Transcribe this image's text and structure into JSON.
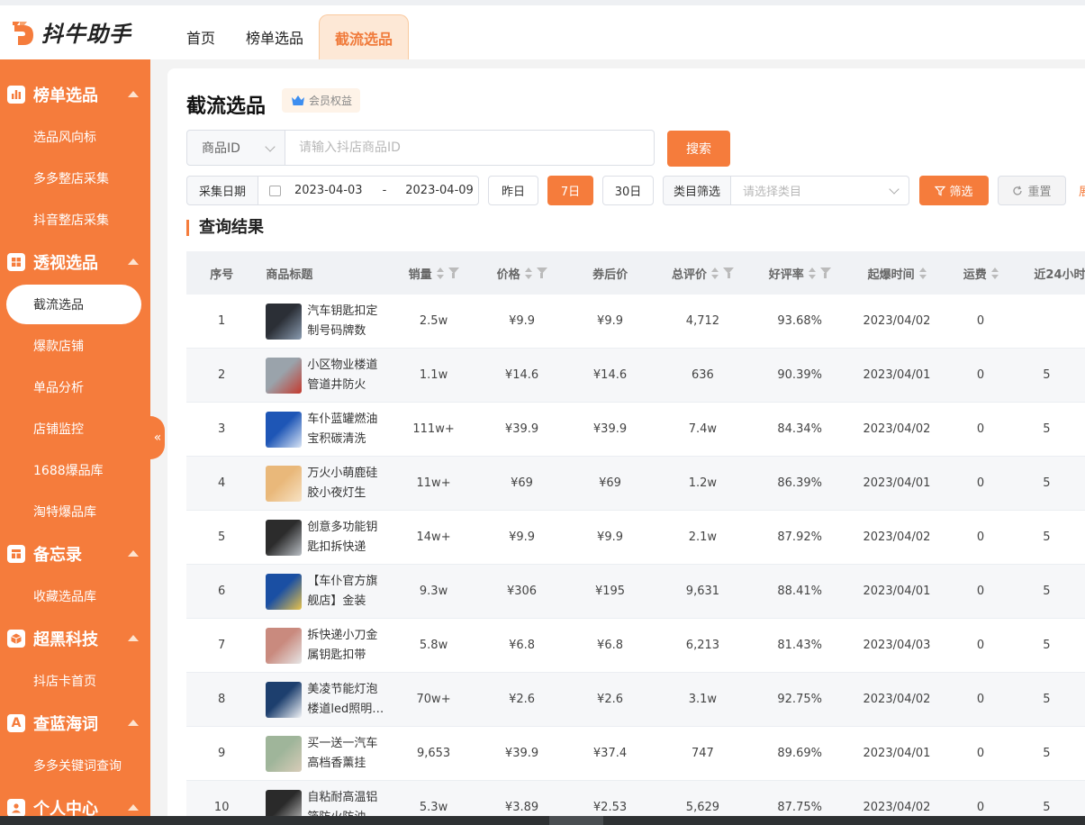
{
  "app": {
    "name": "抖牛助手"
  },
  "nav": {
    "tabs": [
      "首页",
      "榜单选品",
      "截流选品"
    ],
    "active": 2
  },
  "sidebar": {
    "sections": [
      {
        "label": "榜单选品",
        "icon": "bar-chart-icon",
        "items": [
          "选品风向标",
          "多多整店采集",
          "抖音整店采集"
        ]
      },
      {
        "label": "透视选品",
        "icon": "grid-icon",
        "items": [
          "截流选品",
          "爆款店铺",
          "单品分析",
          "店铺监控",
          "1688爆品库",
          "淘特爆品库"
        ]
      },
      {
        "label": "备忘录",
        "icon": "notebook-icon",
        "items": [
          "收藏选品库"
        ]
      },
      {
        "label": "超黑科技",
        "icon": "cube-icon",
        "items": [
          "抖店卡首页"
        ]
      },
      {
        "label": "查蓝海词",
        "icon": "letter-a-icon",
        "items": [
          "多多关键词查询"
        ]
      },
      {
        "label": "个人中心",
        "icon": "user-icon",
        "items": []
      }
    ],
    "active_item": "截流选品",
    "collapse_glyph": "«"
  },
  "page": {
    "title": "截流选品",
    "vip_badge": "会员权益"
  },
  "search": {
    "field_select": "商品ID",
    "placeholder": "请输入抖店商品ID",
    "button": "搜索"
  },
  "filters": {
    "date_label": "采集日期",
    "date_start": "2023-04-03",
    "date_sep": "-",
    "date_end": "2023-04-09",
    "quick_ranges": [
      "昨日",
      "7日",
      "30日"
    ],
    "quick_active": "7日",
    "category_label": "类目筛选",
    "category_placeholder": "请选择类目",
    "filter_button": "筛选",
    "reset_button": "重置",
    "trailing_cut": "展"
  },
  "results": {
    "title": "查询结果",
    "columns": [
      "序号",
      "商品标题",
      "销量",
      "价格",
      "券后价",
      "总评价",
      "好评率",
      "起爆时间",
      "运费",
      "近24小时"
    ],
    "rows": [
      {
        "no": "1",
        "title": "汽车钥匙扣定制号码牌数字…",
        "sales": "2.5w",
        "price": "¥9.9",
        "after": "¥9.9",
        "reviews": "4,712",
        "rate": "93.68%",
        "date": "2023/04/02",
        "ship": "0",
        "h24": "",
        "thumb": [
          "#2b2f36",
          "#8a9bb0"
        ]
      },
      {
        "no": "2",
        "title": "小区物业楼道管道井防火门…",
        "sales": "1.1w",
        "price": "¥14.6",
        "after": "¥14.6",
        "reviews": "636",
        "rate": "90.39%",
        "date": "2023/04/01",
        "ship": "0",
        "h24": "5",
        "thumb": [
          "#9aa3ab",
          "#c53a2e"
        ]
      },
      {
        "no": "3",
        "title": "车仆蓝罐燃油宝积碳清洗剂…",
        "sales": "111w+",
        "price": "¥39.9",
        "after": "¥39.9",
        "reviews": "7.4w",
        "rate": "84.34%",
        "date": "2023/04/02",
        "ship": "0",
        "h24": "5",
        "thumb": [
          "#1e56b6",
          "#d9e4f5"
        ]
      },
      {
        "no": "4",
        "title": "万火小萌鹿硅胶小夜灯生日…",
        "sales": "11w+",
        "price": "¥69",
        "after": "¥69",
        "reviews": "1.2w",
        "rate": "86.39%",
        "date": "2023/04/01",
        "ship": "0",
        "h24": "5",
        "thumb": [
          "#e9b87a",
          "#f7e2c4"
        ]
      },
      {
        "no": "5",
        "title": "创意多功能钥匙扣拆快递刀…",
        "sales": "14w+",
        "price": "¥9.9",
        "after": "¥9.9",
        "reviews": "2.1w",
        "rate": "87.92%",
        "date": "2023/04/02",
        "ship": "0",
        "h24": "5",
        "thumb": [
          "#2c2c2c",
          "#b9bec4"
        ]
      },
      {
        "no": "6",
        "title": "【车仆官方旗舰店】金装燃…",
        "sales": "9.3w",
        "price": "¥306",
        "after": "¥195",
        "reviews": "9,631",
        "rate": "88.41%",
        "date": "2023/04/01",
        "ship": "0",
        "h24": "5",
        "thumb": [
          "#1a4fa3",
          "#e8c24a"
        ]
      },
      {
        "no": "7",
        "title": "拆快递小刀金属钥匙扣带开…",
        "sales": "5.8w",
        "price": "¥6.8",
        "after": "¥6.8",
        "reviews": "6,213",
        "rate": "81.43%",
        "date": "2023/04/03",
        "ship": "0",
        "h24": "5",
        "thumb": [
          "#c98a7e",
          "#e6e6e6"
        ]
      },
      {
        "no": "8",
        "title": "美凌节能灯泡楼道led照明…",
        "sales": "70w+",
        "price": "¥2.6",
        "after": "¥2.6",
        "reviews": "3.1w",
        "rate": "92.75%",
        "date": "2023/04/02",
        "ship": "0",
        "h24": "5",
        "thumb": [
          "#1d3f6e",
          "#f2f4f7"
        ]
      },
      {
        "no": "9",
        "title": "买一送一汽车高档香薰挂件…",
        "sales": "9,653",
        "price": "¥39.9",
        "after": "¥37.4",
        "reviews": "747",
        "rate": "89.69%",
        "date": "2023/04/01",
        "ship": "0",
        "h24": "5",
        "thumb": [
          "#9fb59a",
          "#d8ccb8"
        ]
      },
      {
        "no": "10",
        "title": "自粘耐高温铝箔防火防油…",
        "sales": "5.3w",
        "price": "¥3.89",
        "after": "¥2.53",
        "reviews": "5,629",
        "rate": "87.75%",
        "date": "2023/04/02",
        "ship": "0",
        "h24": "5",
        "thumb": [
          "#2a2a2a",
          "#c6c6c6"
        ]
      }
    ]
  },
  "colors": {
    "accent": "#f57c3c",
    "active_tab_bg": "#fde8d6",
    "header_bg": "#f0f2f5"
  }
}
